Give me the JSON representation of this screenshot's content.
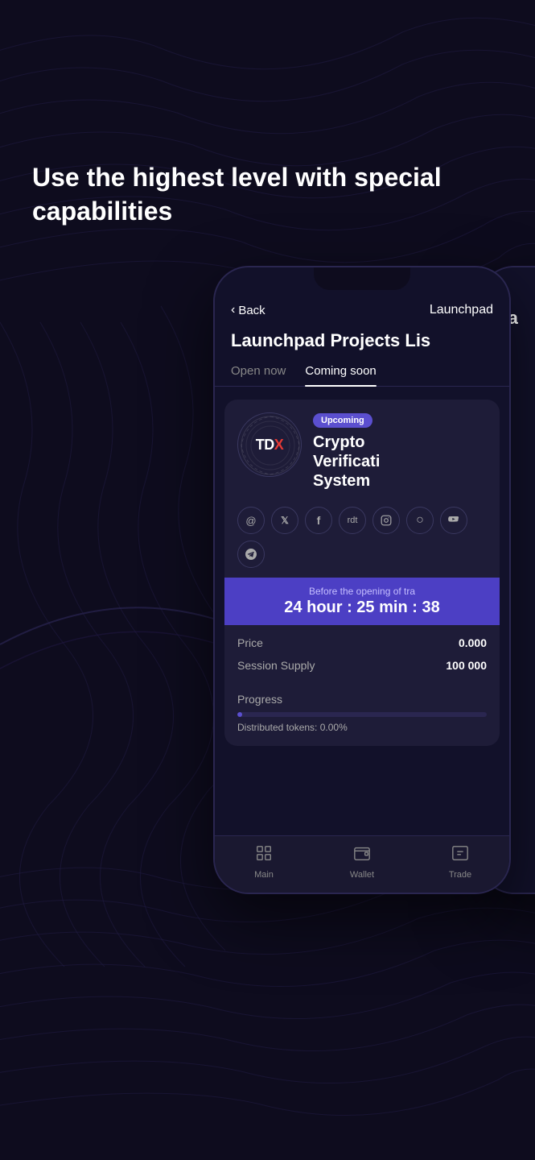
{
  "page": {
    "background_color": "#0e0c1e",
    "headline": "Use the highest level with special capabilities"
  },
  "phone1": {
    "header": {
      "back_label": "Back",
      "title": "Launchpad"
    },
    "page_title": "Launchpad Projects Lis",
    "tabs": [
      {
        "label": "Open now",
        "active": false
      },
      {
        "label": "Coming soon",
        "active": true
      }
    ],
    "project": {
      "badge": "Upcoming",
      "name_line1": "Crypto",
      "name_line2": "Verificati",
      "name_line3": "System",
      "logo_text": "TDX"
    },
    "social_icons": [
      "@",
      "𝕏",
      "f",
      "r",
      "📷",
      "○"
    ],
    "social_icons2": [
      "▶",
      "✈"
    ],
    "countdown": {
      "label": "Before the opening of tra",
      "time": "24 hour : 25 min : 38"
    },
    "details": [
      {
        "label": "Price",
        "value": "0.000"
      },
      {
        "label": "Session Supply",
        "value": "100 000"
      }
    ],
    "progress": {
      "title": "Progress",
      "fill_percent": 2,
      "distributed_text": "Distributed tokens: 0.00%"
    },
    "bottom_nav": [
      {
        "icon": "⊞",
        "label": "Main"
      },
      {
        "icon": "▣",
        "label": "Wallet"
      },
      {
        "icon": "⊟",
        "label": "Trade"
      }
    ]
  },
  "phone2": {
    "visible_label": "Ea"
  }
}
